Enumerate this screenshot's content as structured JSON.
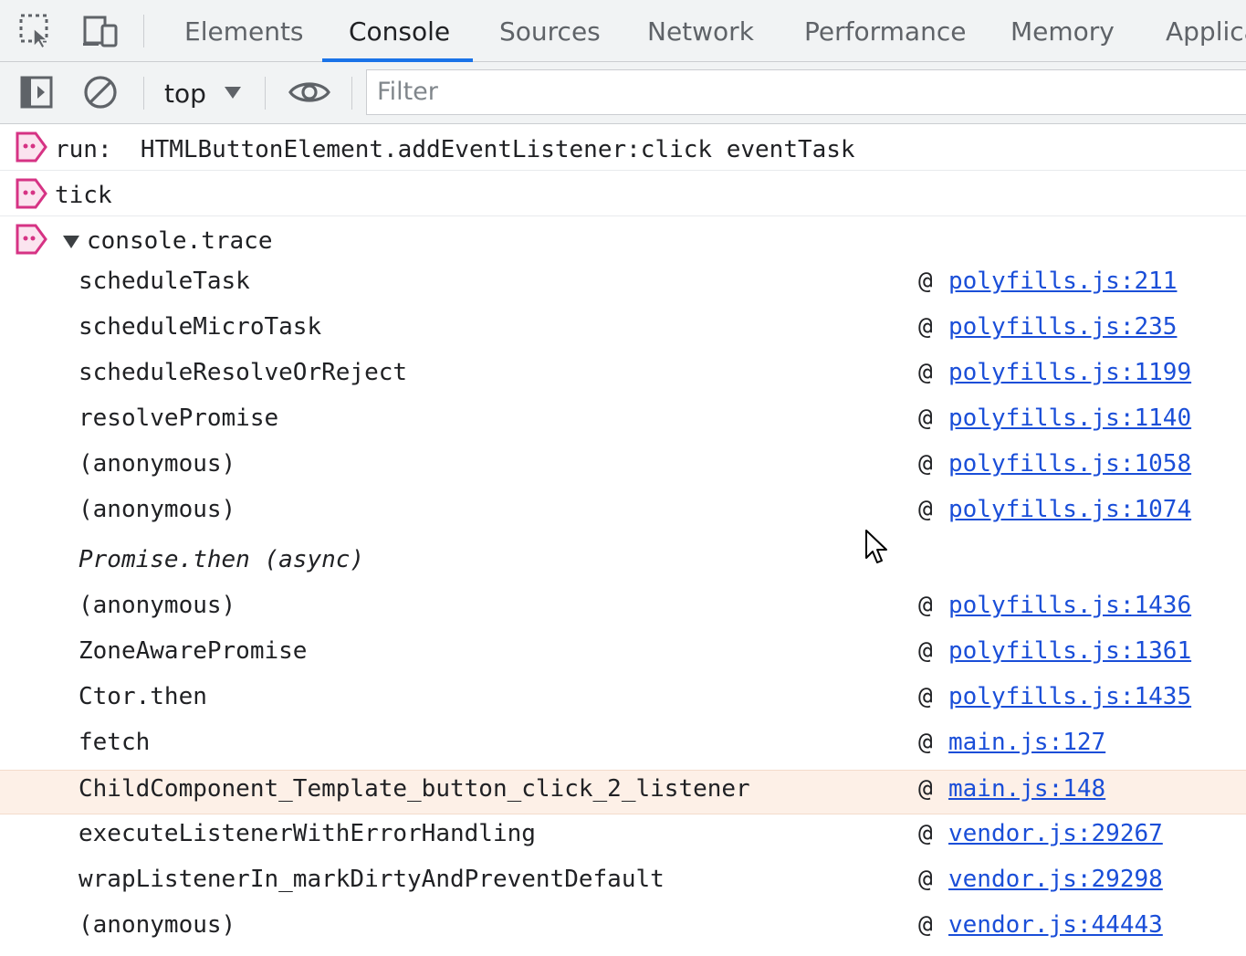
{
  "tabs": [
    {
      "label": "Elements",
      "active": false
    },
    {
      "label": "Console",
      "active": true
    },
    {
      "label": "Sources",
      "active": false
    },
    {
      "label": "Network",
      "active": false
    },
    {
      "label": "Performance",
      "active": false
    },
    {
      "label": "Memory",
      "active": false
    },
    {
      "label": "Applica",
      "active": false
    }
  ],
  "toolbar": {
    "context": "top",
    "filter_placeholder": "Filter"
  },
  "messages": [
    {
      "text": "run:  HTMLButtonElement.addEventListener:click eventTask"
    },
    {
      "text": "tick"
    },
    {
      "text": "console.trace"
    }
  ],
  "trace": [
    {
      "fn": "scheduleTask",
      "at": "@",
      "loc": "polyfills.js:211"
    },
    {
      "fn": "scheduleMicroTask",
      "at": "@",
      "loc": "polyfills.js:235"
    },
    {
      "fn": "scheduleResolveOrReject",
      "at": "@",
      "loc": "polyfills.js:1199"
    },
    {
      "fn": "resolvePromise",
      "at": "@",
      "loc": "polyfills.js:1140"
    },
    {
      "fn": "(anonymous)",
      "at": "@",
      "loc": "polyfills.js:1058"
    },
    {
      "fn": "(anonymous)",
      "at": "@",
      "loc": "polyfills.js:1074"
    },
    {
      "fn": "Promise.then (async)"
    },
    {
      "fn": "(anonymous)",
      "at": "@",
      "loc": "polyfills.js:1436"
    },
    {
      "fn": "ZoneAwarePromise",
      "at": "@",
      "loc": "polyfills.js:1361"
    },
    {
      "fn": "Ctor.then",
      "at": "@",
      "loc": "polyfills.js:1435"
    },
    {
      "fn": "fetch",
      "at": "@",
      "loc": "main.js:127"
    },
    {
      "fn": "ChildComponent_Template_button_click_2_listener",
      "at": "@",
      "loc": "main.js:148"
    },
    {
      "fn": "executeListenerWithErrorHandling",
      "at": "@",
      "loc": "vendor.js:29267"
    },
    {
      "fn": "wrapListenerIn_markDirtyAndPreventDefault",
      "at": "@",
      "loc": "vendor.js:29298"
    },
    {
      "fn": "(anonymous)",
      "at": "@",
      "loc": "vendor.js:44443"
    }
  ],
  "colors": {
    "accent": "#1a73e8",
    "badge": "#d63384",
    "link": "#1a4ed8",
    "highlight_row": "#fdf0e7"
  },
  "icons": [
    "inspect-element-icon",
    "device-toolbar-icon",
    "sidebar-toggle-icon",
    "clear-console-icon",
    "dropdown-arrow-icon",
    "live-expression-eye-icon",
    "message-badge-icon",
    "expand-triangle-icon",
    "mouse-cursor-icon"
  ]
}
